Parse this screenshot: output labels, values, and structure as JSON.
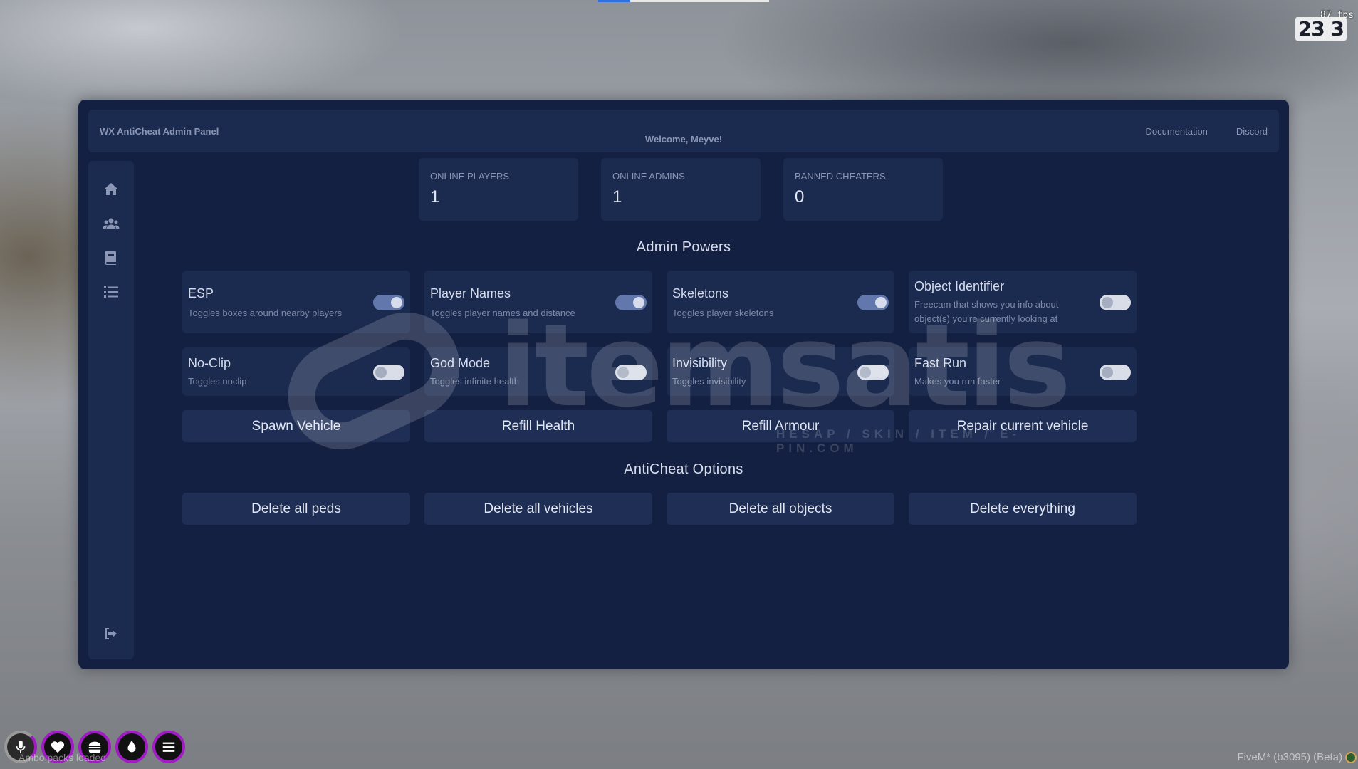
{
  "hud": {
    "fps": "87 fps",
    "clock": "23 3",
    "loading_text": "Ambo packs loaded",
    "client_version": "FiveM* (b3095) (Beta)",
    "circle_icons": [
      "microphone-icon",
      "heart-icon",
      "food-icon",
      "water-drop-icon",
      "menu-icon"
    ]
  },
  "header": {
    "brand": "WX AntiCheat Admin Panel",
    "welcome": "Welcome, Meyve!",
    "links": [
      "Documentation",
      "Discord"
    ]
  },
  "sidebar": {
    "icons": [
      "home-icon",
      "users-icon",
      "book-icon",
      "list-icon"
    ],
    "logout_icon": "logout-icon"
  },
  "stats": [
    {
      "label": "ONLINE PLAYERS",
      "value": "1"
    },
    {
      "label": "ONLINE ADMINS",
      "value": "1"
    },
    {
      "label": "BANNED CHEATERS",
      "value": "0"
    }
  ],
  "admin_powers": {
    "title": "Admin Powers",
    "toggles": [
      {
        "title": "ESP",
        "desc": "Toggles boxes around nearby players",
        "on": true
      },
      {
        "title": "Player Names",
        "desc": "Toggles player names and distance",
        "on": true
      },
      {
        "title": "Skeletons",
        "desc": "Toggles player skeletons",
        "on": true
      },
      {
        "title": "Object Identifier",
        "desc": "Freecam that shows you info about object(s) you're currently looking at",
        "on": false
      },
      {
        "title": "No-Clip",
        "desc": "Toggles noclip",
        "on": false
      },
      {
        "title": "God Mode",
        "desc": "Toggles infinite health",
        "on": false
      },
      {
        "title": "Invisibility",
        "desc": "Toggles invisibility",
        "on": false
      },
      {
        "title": "Fast Run",
        "desc": "Makes you run faster",
        "on": false
      }
    ],
    "buttons": [
      "Spawn Vehicle",
      "Refill Health",
      "Refill Armour",
      "Repair current vehicle"
    ]
  },
  "anticheat_options": {
    "title": "AntiCheat Options",
    "buttons": [
      "Delete all peds",
      "Delete all vehicles",
      "Delete all objects",
      "Delete everything"
    ]
  },
  "watermark": {
    "text": "itemsatis",
    "sub": "HESAP / SKIN / ITEM / E-PIN.COM"
  }
}
